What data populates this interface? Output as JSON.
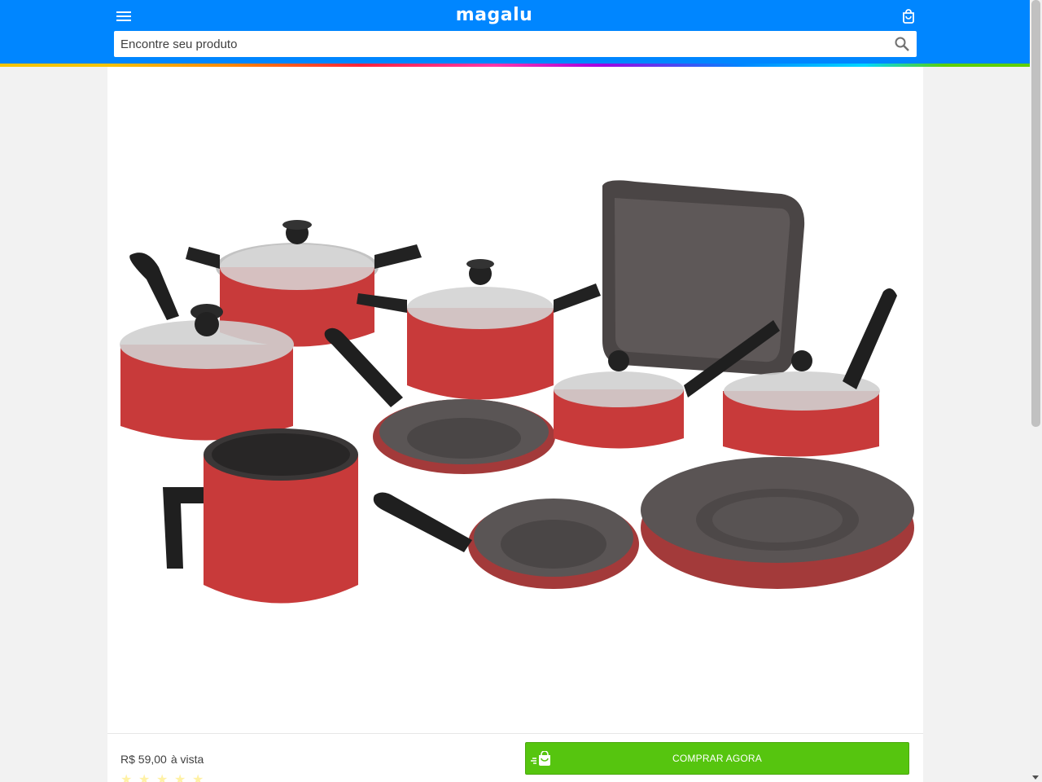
{
  "header": {
    "logo_text": "magalu",
    "menu_icon": "hamburger-menu-icon",
    "bag_icon": "shopping-bag-icon",
    "brand_color": "#0086ff"
  },
  "search": {
    "placeholder": "Encontre seu produto",
    "value": "",
    "icon": "search-icon"
  },
  "product": {
    "image_alt": "Jogo de panelas vermelhas antiaderentes",
    "price": "R$ 59,00",
    "price_suffix": "à vista",
    "buy_label": "COMPRAR AGORA",
    "buy_color": "#56c50f",
    "rating_stars": 5
  }
}
